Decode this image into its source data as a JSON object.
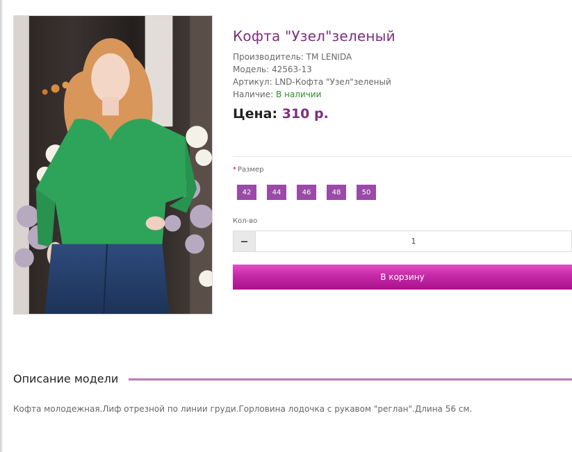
{
  "product": {
    "title": "Кофта \"Узел\"зеленый",
    "manufacturer_label": "Производитель:",
    "manufacturer_value": "ТМ LENIDA",
    "model_label": "Модель:",
    "model_value": "42563-13",
    "sku_label": "Артикул:",
    "sku_value": "LND-Кофта \"Узел\"зеленый",
    "availability_label": "Наличие:",
    "availability_value": "В наличии",
    "price_label": "Цена:",
    "price_value": "310 р."
  },
  "options": {
    "size_required_mark": "*",
    "size_label": "Размер",
    "sizes": [
      "42",
      "44",
      "46",
      "48",
      "50"
    ],
    "qty_label": "Кол-во",
    "qty_value": "1"
  },
  "cart_button_label": "В корзину",
  "description": {
    "heading": "Описание модели",
    "text": "Кофта молодежная.Лиф отрезной по линии груди.Горловина лодочка с рукавом \"реглан\".Длина 56 см."
  },
  "colors": {
    "accent": "#7b2f7f",
    "size_button": "#9a4aa8",
    "cart_button": "#c629a6",
    "in_stock": "#2e8b2e"
  }
}
